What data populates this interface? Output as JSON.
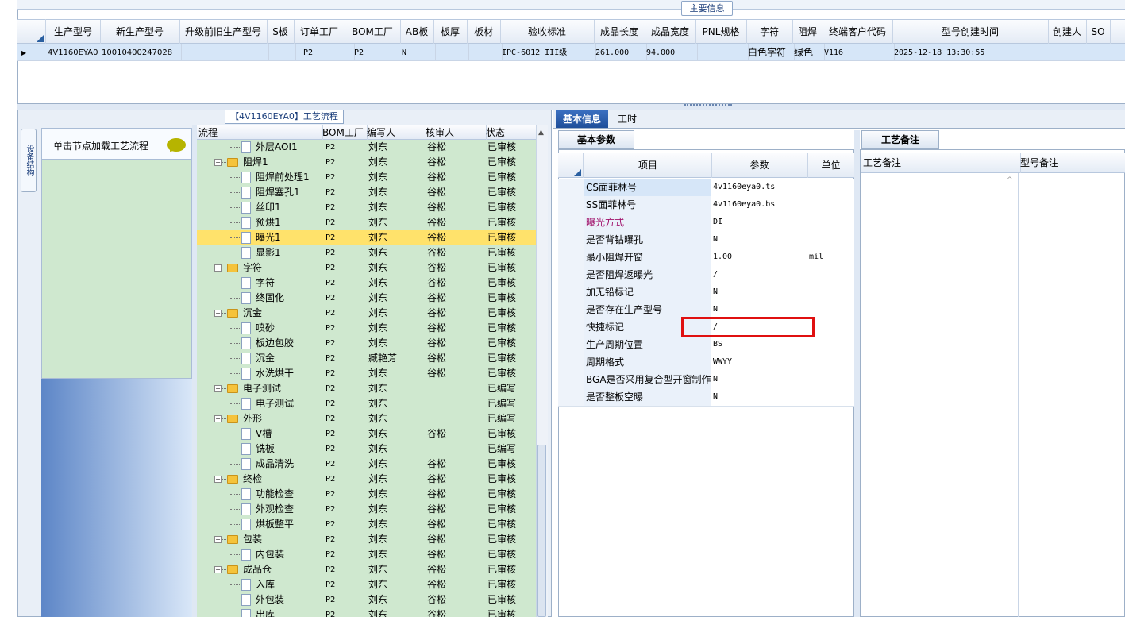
{
  "top": {
    "tab_label": "主要信息",
    "columns": [
      "生产型号",
      "新生产型号",
      "升级前旧生产型号",
      "S板",
      "订单工厂",
      "BOM工厂",
      "AB板",
      "板厚",
      "板材",
      "验收标准",
      "成品长度",
      "成品宽度",
      "PNL规格",
      "字符",
      "阻焊",
      "终端客户代码",
      "型号创建时间",
      "创建人",
      "SO"
    ],
    "row": [
      "4V1160EYA0",
      "10010400247028",
      "",
      "",
      "P2",
      "P2",
      "N",
      "",
      "",
      "IPC-6012 III级",
      "261.000",
      "94.000",
      "",
      "白色字符",
      "绿色",
      "V116",
      "2025-12-18 13:30:55",
      "",
      ""
    ]
  },
  "left": {
    "flow_title": "【4V1160EYA0】工艺流程",
    "vtab_label": "设备结构",
    "click_hint": "单击节点加载工艺流程",
    "tree_columns": [
      "流程",
      "BOM工厂",
      "编写人",
      "核审人",
      "状态"
    ],
    "rows": [
      {
        "kind": "doc",
        "name": "外层AOI1",
        "bom": "P2",
        "writer": "刘东",
        "reviewer": "谷松",
        "status": "已审核"
      },
      {
        "kind": "folder",
        "name": "阻焊1",
        "bom": "P2",
        "writer": "刘东",
        "reviewer": "谷松",
        "status": "已审核"
      },
      {
        "kind": "doc",
        "name": "阻焊前处理1",
        "bom": "P2",
        "writer": "刘东",
        "reviewer": "谷松",
        "status": "已审核"
      },
      {
        "kind": "doc",
        "name": "阻焊塞孔1",
        "bom": "P2",
        "writer": "刘东",
        "reviewer": "谷松",
        "status": "已审核"
      },
      {
        "kind": "doc",
        "name": "丝印1",
        "bom": "P2",
        "writer": "刘东",
        "reviewer": "谷松",
        "status": "已审核"
      },
      {
        "kind": "doc",
        "name": "预烘1",
        "bom": "P2",
        "writer": "刘东",
        "reviewer": "谷松",
        "status": "已审核"
      },
      {
        "kind": "doc",
        "name": "曝光1",
        "bom": "P2",
        "writer": "刘东",
        "reviewer": "谷松",
        "status": "已审核",
        "selected": true
      },
      {
        "kind": "doc",
        "name": "显影1",
        "bom": "P2",
        "writer": "刘东",
        "reviewer": "谷松",
        "status": "已审核"
      },
      {
        "kind": "folder",
        "name": "字符",
        "bom": "P2",
        "writer": "刘东",
        "reviewer": "谷松",
        "status": "已审核"
      },
      {
        "kind": "doc",
        "name": "字符",
        "bom": "P2",
        "writer": "刘东",
        "reviewer": "谷松",
        "status": "已审核"
      },
      {
        "kind": "doc",
        "name": "终固化",
        "bom": "P2",
        "writer": "刘东",
        "reviewer": "谷松",
        "status": "已审核"
      },
      {
        "kind": "folder",
        "name": "沉金",
        "bom": "P2",
        "writer": "刘东",
        "reviewer": "谷松",
        "status": "已审核"
      },
      {
        "kind": "doc",
        "name": "喷砂",
        "bom": "P2",
        "writer": "刘东",
        "reviewer": "谷松",
        "status": "已审核"
      },
      {
        "kind": "doc",
        "name": "板边包胶",
        "bom": "P2",
        "writer": "刘东",
        "reviewer": "谷松",
        "status": "已审核"
      },
      {
        "kind": "doc",
        "name": "沉金",
        "bom": "P2",
        "writer": "臧艳芳",
        "reviewer": "谷松",
        "status": "已审核"
      },
      {
        "kind": "doc",
        "name": "水洗烘干",
        "bom": "P2",
        "writer": "刘东",
        "reviewer": "谷松",
        "status": "已审核"
      },
      {
        "kind": "folder",
        "name": "电子测试",
        "bom": "P2",
        "writer": "刘东",
        "reviewer": "",
        "status": "已编写"
      },
      {
        "kind": "doc",
        "name": "电子测试",
        "bom": "P2",
        "writer": "刘东",
        "reviewer": "",
        "status": "已编写"
      },
      {
        "kind": "folder",
        "name": "外形",
        "bom": "P2",
        "writer": "刘东",
        "reviewer": "",
        "status": "已编写"
      },
      {
        "kind": "doc",
        "name": "V槽",
        "bom": "P2",
        "writer": "刘东",
        "reviewer": "谷松",
        "status": "已审核"
      },
      {
        "kind": "doc",
        "name": "铣板",
        "bom": "P2",
        "writer": "刘东",
        "reviewer": "",
        "status": "已编写"
      },
      {
        "kind": "doc",
        "name": "成品清洗",
        "bom": "P2",
        "writer": "刘东",
        "reviewer": "谷松",
        "status": "已审核"
      },
      {
        "kind": "folder",
        "name": "终检",
        "bom": "P2",
        "writer": "刘东",
        "reviewer": "谷松",
        "status": "已审核"
      },
      {
        "kind": "doc",
        "name": "功能检查",
        "bom": "P2",
        "writer": "刘东",
        "reviewer": "谷松",
        "status": "已审核"
      },
      {
        "kind": "doc",
        "name": "外观检查",
        "bom": "P2",
        "writer": "刘东",
        "reviewer": "谷松",
        "status": "已审核"
      },
      {
        "kind": "doc",
        "name": "烘板整平",
        "bom": "P2",
        "writer": "刘东",
        "reviewer": "谷松",
        "status": "已审核"
      },
      {
        "kind": "folder",
        "name": "包装",
        "bom": "P2",
        "writer": "刘东",
        "reviewer": "谷松",
        "status": "已审核"
      },
      {
        "kind": "doc",
        "name": "内包装",
        "bom": "P2",
        "writer": "刘东",
        "reviewer": "谷松",
        "status": "已审核"
      },
      {
        "kind": "folder",
        "name": "成品仓",
        "bom": "P2",
        "writer": "刘东",
        "reviewer": "谷松",
        "status": "已审核"
      },
      {
        "kind": "doc",
        "name": "入库",
        "bom": "P2",
        "writer": "刘东",
        "reviewer": "谷松",
        "status": "已审核"
      },
      {
        "kind": "doc",
        "name": "外包装",
        "bom": "P2",
        "writer": "刘东",
        "reviewer": "谷松",
        "status": "已审核"
      },
      {
        "kind": "doc",
        "name": "出库",
        "bom": "P2",
        "writer": "刘东",
        "reviewer": "谷松",
        "status": "已审核"
      }
    ]
  },
  "right": {
    "tabs": [
      "基本信息",
      "工时"
    ],
    "subtab": "基本参数",
    "param_columns": [
      "项目",
      "参数",
      "单位"
    ],
    "params": [
      {
        "name": "CS面菲林号",
        "value": "4v1160eya0.ts",
        "unit": ""
      },
      {
        "name": "SS面菲林号",
        "value": "4v1160eya0.bs",
        "unit": ""
      },
      {
        "name": "曝光方式",
        "value": "DI",
        "unit": "",
        "highlight_color": "#a0106a"
      },
      {
        "name": "是否背钻曝孔",
        "value": "N",
        "unit": ""
      },
      {
        "name": "最小阻焊开窗",
        "value": "1.00",
        "unit": "mil"
      },
      {
        "name": "是否阻焊返曝光",
        "value": "/",
        "unit": ""
      },
      {
        "name": "加无铅标记",
        "value": "N",
        "unit": ""
      },
      {
        "name": "是否存在生产型号",
        "value": "N",
        "unit": ""
      },
      {
        "name": "快捷标记",
        "value": "/",
        "unit": ""
      },
      {
        "name": "生产周期位置",
        "value": "BS",
        "unit": ""
      },
      {
        "name": "周期格式",
        "value": "WWYY",
        "unit": ""
      },
      {
        "name": "BGA是否采用复合型开窗制作",
        "value": "N",
        "unit": ""
      },
      {
        "name": "是否整板空曝",
        "value": "N",
        "unit": ""
      }
    ],
    "notes_tab": "工艺备注",
    "notes_columns": [
      "工艺备注",
      "型号备注"
    ]
  }
}
